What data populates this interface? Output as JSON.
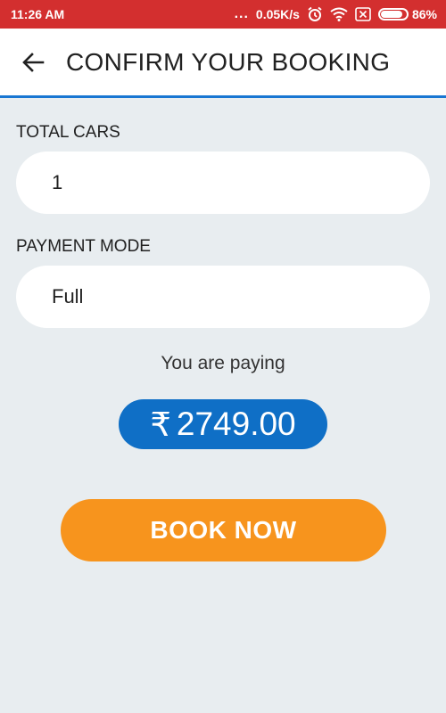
{
  "status_bar": {
    "time": "11:26 AM",
    "dots": "...",
    "network_speed": "0.05K/s",
    "battery_percent": "86%",
    "battery_level": 0.86,
    "icons": [
      "alarm-icon",
      "wifi-icon",
      "no-sim-icon",
      "battery-icon"
    ]
  },
  "header": {
    "title": "CONFIRM YOUR BOOKING",
    "back_icon": "arrow-back-icon",
    "accent_color": "#1976d2"
  },
  "form": {
    "total_cars_label": "TOTAL CARS",
    "total_cars_value": "1",
    "payment_mode_label": "PAYMENT MODE",
    "payment_mode_value": "Full"
  },
  "payment": {
    "paying_label": "You are paying",
    "currency_symbol": "₹",
    "amount": "2749.00",
    "pill_color": "#0f6fc6"
  },
  "actions": {
    "book_now_label": "BOOK NOW",
    "button_color": "#f7941d"
  }
}
